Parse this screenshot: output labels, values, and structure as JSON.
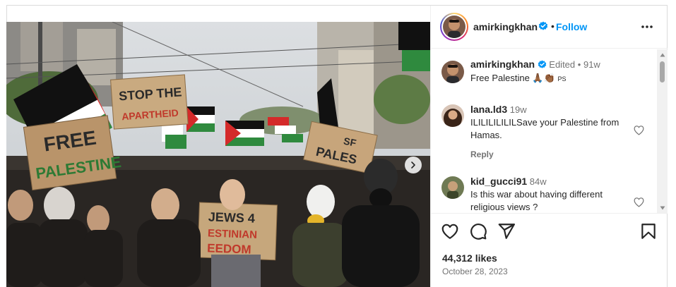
{
  "post": {
    "author": {
      "username": "amirkingkhan",
      "verified_icon": "verified-badge-icon",
      "follow_label": "Follow",
      "separator": "•"
    },
    "caption": {
      "username": "amirkingkhan",
      "edited_label": "Edited",
      "separator": "•",
      "age": "91w",
      "text": "Free Palestine 🙏🏾👏🏾",
      "text_suffix": "ps"
    },
    "comments": [
      {
        "username": "lana.ld3",
        "age": "19w",
        "text": "ILILILILILILSave your Palestine from Hamas.",
        "reply_label": "Reply"
      },
      {
        "username": "kid_gucci91",
        "age": "84w",
        "text": "Is this war about having different religious views ?"
      }
    ],
    "likes": "44,312 likes",
    "date": "October 28, 2023",
    "photo": {
      "signs": [
        "FREE",
        "PALESTINE",
        "STOP THE",
        "APARTHEID",
        "JEWS 4",
        "ESTINIAN",
        "EEDOM",
        "SF",
        "PALES"
      ]
    }
  },
  "icons": {
    "more": "more-options-icon",
    "like": "heart-icon",
    "comment": "comment-icon",
    "share": "share-icon",
    "save": "bookmark-icon",
    "carousel_next": "chevron-right-icon"
  },
  "colors": {
    "follow_blue": "#0095f6",
    "verified_blue": "#0095f6",
    "text": "#262626",
    "muted": "#737373"
  }
}
